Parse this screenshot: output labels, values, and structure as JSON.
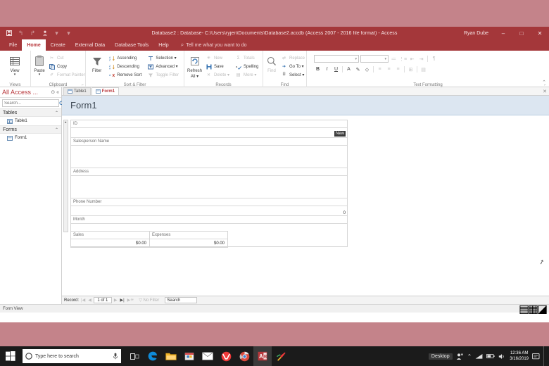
{
  "window": {
    "title": "Database2 : Database- C:\\Users\\ryjen\\Documents\\Database2.accdb (Access 2007 - 2016 file format)  -  Access",
    "user": "Ryan Dube",
    "minimize": "–",
    "maximize": "□",
    "close": "✕",
    "accent": "#a4373a"
  },
  "quick_access": {
    "save": "save-icon",
    "undo": "undo-icon",
    "redo": "redo-icon",
    "customize": "customize-icon",
    "dropdown": "▾"
  },
  "ribbon": {
    "tabs": [
      {
        "label": "File",
        "active": false
      },
      {
        "label": "Home",
        "active": true
      },
      {
        "label": "Create",
        "active": false
      },
      {
        "label": "External Data",
        "active": false
      },
      {
        "label": "Database Tools",
        "active": false
      },
      {
        "label": "Help",
        "active": false
      }
    ],
    "tell_me": "Tell me what you want to do",
    "collapse": "⌃",
    "groups": [
      {
        "name": "Views",
        "big": {
          "label": "View",
          "caret": "▾",
          "icon": "view-grid-icon"
        }
      },
      {
        "name": "Clipboard",
        "big": {
          "label": "Paste",
          "caret": "▾",
          "icon": "clipboard-icon"
        },
        "items": [
          {
            "label": "Cut",
            "icon": "scissors-icon",
            "disabled": true
          },
          {
            "label": "Copy",
            "icon": "copy-icon",
            "disabled": false
          },
          {
            "label": "Format Painter",
            "icon": "format-painter-icon",
            "disabled": true
          }
        ],
        "launcher": "⌐"
      },
      {
        "name": "Sort & Filter",
        "big": {
          "label": "Filter",
          "caret": "",
          "icon": "funnel-icon"
        },
        "items": [
          {
            "label": "Ascending",
            "icon": "sort-ascending-icon",
            "disabled": false
          },
          {
            "label": "Descending",
            "icon": "sort-descending-icon",
            "disabled": false
          },
          {
            "label": "Remove Sort",
            "icon": "remove-sort-icon",
            "disabled": false
          }
        ],
        "items2": [
          {
            "label": "Selection ▾",
            "icon": "selection-icon",
            "disabled": false
          },
          {
            "label": "Advanced ▾",
            "icon": "advanced-filter-icon",
            "disabled": false
          },
          {
            "label": "Toggle Filter",
            "icon": "toggle-filter-icon",
            "disabled": true
          }
        ]
      },
      {
        "name": "Records",
        "big": {
          "label": "Refresh",
          "label2": "All ▾",
          "icon": "refresh-icon"
        },
        "items": [
          {
            "label": "New",
            "icon": "new-record-icon",
            "disabled": true
          },
          {
            "label": "Save",
            "icon": "save-record-icon",
            "disabled": false
          },
          {
            "label": "Delete ▾",
            "icon": "delete-record-icon",
            "disabled": true
          }
        ],
        "items2": [
          {
            "label": "Totals",
            "icon": "totals-icon",
            "disabled": true
          },
          {
            "label": "Spelling",
            "icon": "spelling-icon",
            "disabled": false
          },
          {
            "label": "More ▾",
            "icon": "more-icon",
            "disabled": true
          }
        ]
      },
      {
        "name": "Find",
        "big": {
          "label": "Find",
          "caret": "",
          "icon": "find-magnifier-icon"
        },
        "items": [
          {
            "label": "Replace",
            "icon": "replace-icon",
            "disabled": true
          },
          {
            "label": "Go To ▾",
            "icon": "goto-icon",
            "disabled": false
          },
          {
            "label": "Select ▾",
            "icon": "select-icon",
            "disabled": false
          }
        ]
      },
      {
        "name": "Text Formatting",
        "font_name": "",
        "font_size": "",
        "caret": "▾",
        "bold": "B",
        "italic": "I",
        "underline": "U",
        "font_color": "A",
        "highlight": "✎",
        "fill_color": "◇",
        "bullets": "≔",
        "numbering": "⋮≡",
        "decrease_indent": "⇤",
        "increase_indent": "⇥",
        "rtl": "¶",
        "align_left": "≡",
        "align_center": "≡",
        "align_right": "≡",
        "align_justify": "≡",
        "datasheet": "⊞",
        "gridlines": "▤",
        "launcher": "⌐"
      }
    ]
  },
  "navpane": {
    "title": "All Access ...",
    "open_icon": "⊙",
    "collapse_icon": "«",
    "search_placeholder": "Search...",
    "search_value": "",
    "search_icon": "search-icon",
    "groups": [
      {
        "name": "Tables",
        "chevron": "⌃",
        "items": [
          {
            "label": "Table1",
            "icon": "table-icon"
          }
        ]
      },
      {
        "name": "Forms",
        "chevron": "⌃",
        "items": [
          {
            "label": "Form1",
            "icon": "form-icon"
          }
        ]
      }
    ]
  },
  "document": {
    "tabs": [
      {
        "label": "Table1",
        "icon": "table-icon",
        "active": false
      },
      {
        "label": "Form1",
        "icon": "form-icon",
        "active": true
      }
    ],
    "close_label": "✕",
    "form_title": "Form1"
  },
  "form": {
    "fields": [
      {
        "label": "ID",
        "value": "",
        "badge": "New",
        "height": "h14"
      },
      {
        "label": "Salesperson Name",
        "value": "",
        "badge": "",
        "height": "h32"
      },
      {
        "label": "Address",
        "value": "",
        "badge": "",
        "height": "h32"
      },
      {
        "label": "Phone Number",
        "value": "0",
        "badge": "",
        "height": "h14"
      },
      {
        "label": "Month",
        "value": "",
        "badge": "",
        "height": "h32"
      }
    ],
    "columns": [
      {
        "header": "Sales",
        "value": "$0.00"
      },
      {
        "header": "Expenses",
        "value": "$0.00"
      }
    ]
  },
  "record_nav": {
    "label": "Record:",
    "first": "|◀",
    "prev": "◀",
    "position": "1 of 1",
    "next": "▶",
    "last": "▶|",
    "new_record": "▶✳",
    "filter_icon": "filter-icon",
    "filter_label": "No Filter",
    "search_placeholder": "Search",
    "search_value": "Search"
  },
  "status_bar": {
    "text": "Form View",
    "views": [
      {
        "name": "form-view-button",
        "glyph": "▤",
        "active": true
      },
      {
        "name": "layout-view-button",
        "glyph": "▦",
        "active": false
      },
      {
        "name": "design-view-button",
        "glyph": "◪",
        "active": false
      }
    ]
  },
  "taskbar": {
    "start": "start-icon",
    "cortana": "cortana-icon",
    "search_placeholder": "Type here to search",
    "mic": "microphone-icon",
    "items": [
      {
        "name": "task-view-icon",
        "glyph": "❐",
        "color": "#d8d8d8",
        "active": false
      },
      {
        "name": "edge-icon",
        "glyph": "e",
        "color": "#0f8bd8",
        "active": false
      },
      {
        "name": "file-explorer-icon",
        "glyph": "▭",
        "color": "#f0b429",
        "active": false
      },
      {
        "name": "microsoft-store-icon",
        "glyph": "▣",
        "color": "#e8e8e8",
        "active": false
      },
      {
        "name": "mail-icon",
        "glyph": "✉",
        "color": "#ffffff",
        "active": false
      },
      {
        "name": "vivaldi-icon",
        "glyph": "V",
        "color": "#ef3939",
        "active": false
      },
      {
        "name": "chrome-icon",
        "glyph": "◉",
        "color": "#d94a3d",
        "active": false
      },
      {
        "name": "access-icon",
        "glyph": "A",
        "color": "#b8373b",
        "active": true
      },
      {
        "name": "paint-icon",
        "glyph": "✂",
        "color": "#e84a5f",
        "active": false
      }
    ],
    "tray": {
      "desktop_label": "Desktop",
      "people_icon": "people-icon",
      "chevron_icon": "⌃",
      "network_icon": "network-icon",
      "battery_icon": "battery-icon",
      "volume_icon": "volume-icon",
      "time": "12:36 AM",
      "date": "3/16/2019",
      "action_center": "notifications-icon"
    }
  }
}
